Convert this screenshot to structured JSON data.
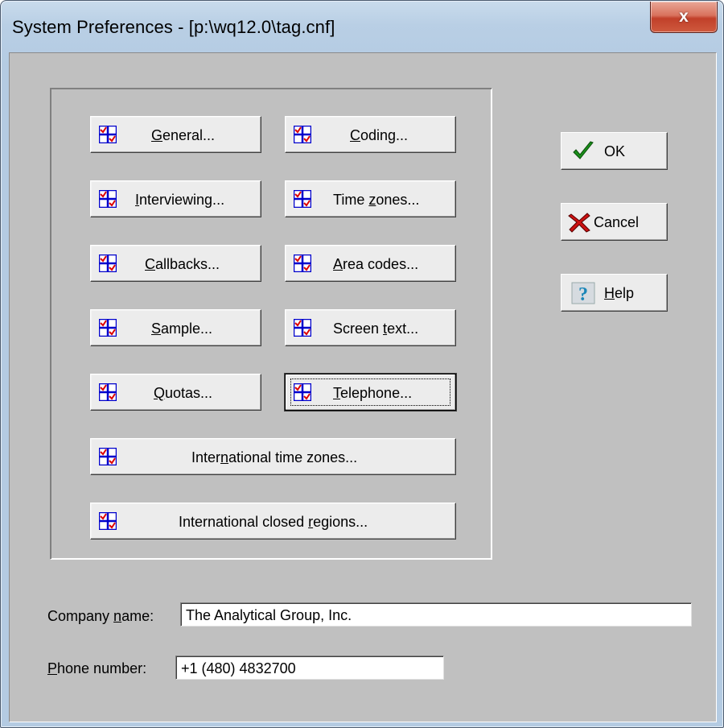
{
  "window": {
    "title": "System Preferences - [p:\\wq12.0\\tag.cnf]",
    "close_label": "x"
  },
  "buttons": {
    "general": {
      "pre": "",
      "ul": "G",
      "post": "eneral..."
    },
    "coding": {
      "pre": "",
      "ul": "C",
      "post": "oding..."
    },
    "interviewing": {
      "pre": "",
      "ul": "I",
      "post": "nterviewing..."
    },
    "time_zones": {
      "pre": "Time ",
      "ul": "z",
      "post": "ones..."
    },
    "callbacks": {
      "pre": "",
      "ul": "C",
      "post": "allbacks..."
    },
    "area_codes": {
      "pre": "",
      "ul": "A",
      "post": "rea codes..."
    },
    "sample": {
      "pre": "",
      "ul": "S",
      "post": "ample..."
    },
    "screen_text": {
      "pre": "Screen ",
      "ul": "t",
      "post": "ext..."
    },
    "quotas": {
      "pre": "",
      "ul": "Q",
      "post": "uotas..."
    },
    "telephone": {
      "pre": "",
      "ul": "T",
      "post": "elephone..."
    },
    "intl_time_zones": {
      "pre": "Inter",
      "ul": "n",
      "post": "ational time zones..."
    },
    "intl_closed_regions": {
      "pre": "International closed ",
      "ul": "r",
      "post": "egions..."
    }
  },
  "side": {
    "ok": {
      "pre": "OK",
      "ul": "",
      "post": ""
    },
    "cancel": {
      "pre": "Cancel",
      "ul": "",
      "post": ""
    },
    "help": {
      "pre": "",
      "ul": "H",
      "post": "elp"
    }
  },
  "fields": {
    "company": {
      "pre": "Company ",
      "ul": "n",
      "post": "ame:",
      "value": "The Analytical Group, Inc."
    },
    "phone": {
      "pre": "",
      "ul": "P",
      "post": "hone number:",
      "value": "+1 (480) 4832700"
    }
  },
  "colors": {
    "dialog_bg": "#c0c0c0",
    "title_bar": "#b9cfe5",
    "close_red": "#c1402a",
    "icon_blue": "#0000cc",
    "icon_red": "#dd0000"
  }
}
